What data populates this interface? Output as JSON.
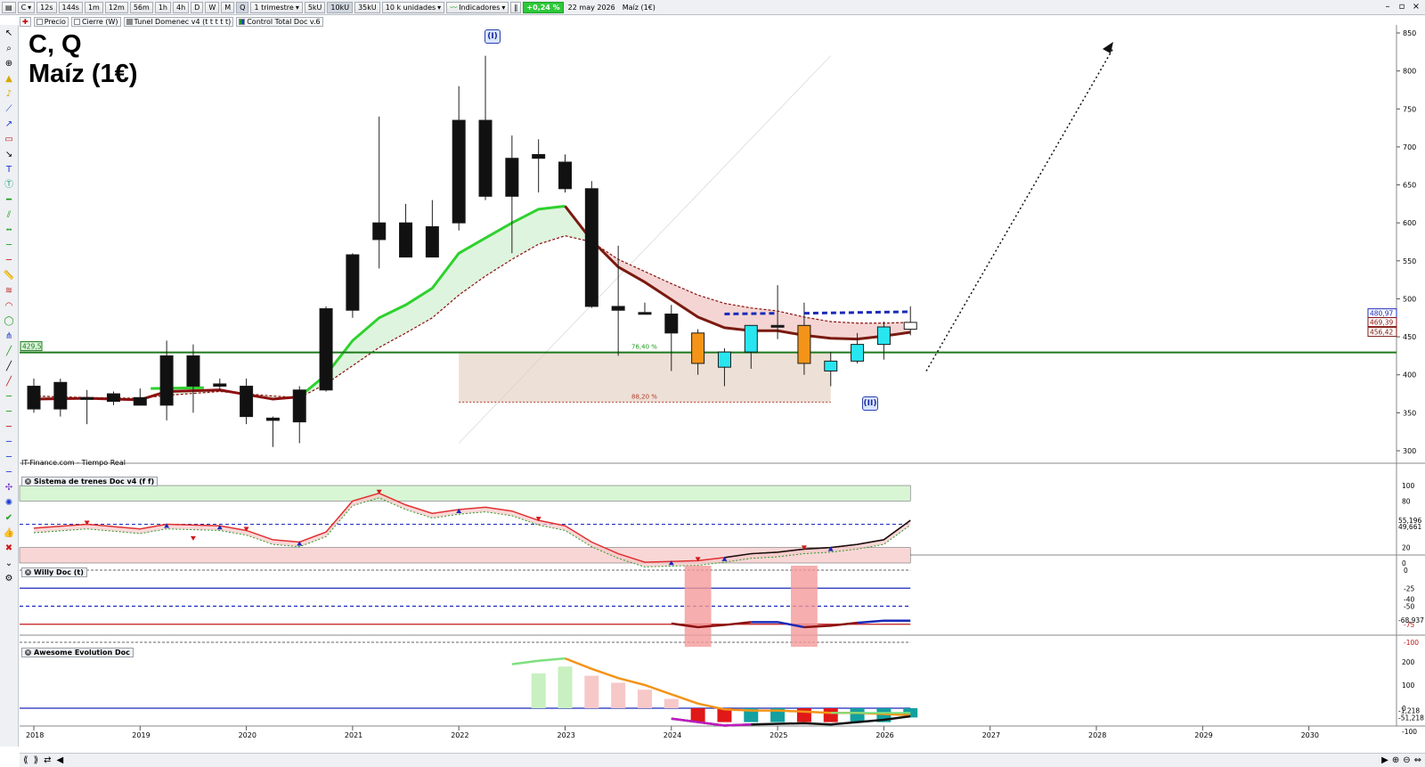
{
  "toolbar": {
    "symbol": "C",
    "timeframes": [
      "12s",
      "144s",
      "1m",
      "12m",
      "56m",
      "1h",
      "4h",
      "D",
      "W",
      "M",
      "Q"
    ],
    "period": "1 trimestre",
    "units": [
      "5kU",
      "10kU",
      "35kU"
    ],
    "units_select": "10 k unidades",
    "indicators_label": "Indicadores",
    "change": "+0,24 %",
    "date": "22 may 2026",
    "instrument": "Maíz (1€)"
  },
  "legend": {
    "price": "Precio",
    "close": "Cierre (W)",
    "tunnel": "Tunel Domenec v4 (t t t t t)",
    "control": "Control Total Doc v.6"
  },
  "title": {
    "line1": "C, Q",
    "line2": "Maíz (1€)"
  },
  "source": "IT-Finance.com - Tiempo Real",
  "waves": {
    "w1": "(I)",
    "w2": "(II)"
  },
  "fib": {
    "f1": "76,40 %",
    "f2": "88,20 %"
  },
  "price_tags": {
    "support": "429,5",
    "a": "480,97",
    "b": "469,39",
    "c": "456,42"
  },
  "panes": {
    "p1": "Sistema de trenes Doc v4 (f f)",
    "p2": "Willy Doc (t)",
    "p3": "Awesome Evolution Doc"
  },
  "pane_values": {
    "p1": [
      "55,196",
      "49,661"
    ],
    "p2": [
      "-68,937"
    ],
    "p3": [
      "-1,218",
      "-51,218"
    ]
  },
  "axes": {
    "price_ticks": [
      850,
      800,
      750,
      700,
      650,
      600,
      550,
      500,
      450,
      400,
      350,
      300
    ],
    "p1_ticks": [
      "100",
      "80",
      "20",
      "0"
    ],
    "p2_ticks": [
      "0",
      "-25",
      "-40",
      "-50",
      "-75",
      "-100"
    ],
    "p3_ticks": [
      "200",
      "100",
      "0",
      "-100"
    ],
    "years": [
      "2018",
      "2019",
      "2020",
      "2021",
      "2022",
      "2023",
      "2024",
      "2025",
      "2026",
      "2027",
      "2028",
      "2029",
      "2030"
    ]
  },
  "colors": {
    "bull_green": "#2ed12e",
    "bear_red": "#8b1010",
    "support_line": "#1c7a1c",
    "fib_box": "#e8d8cc",
    "cyan": "#28e6ef",
    "orange": "#f39419"
  },
  "chart_data": {
    "type": "candlestick",
    "timeframe": "quarterly",
    "series": [
      {
        "name": "candles",
        "ohlc": [
          [
            2018.0,
            385,
            395,
            350,
            355
          ],
          [
            2018.25,
            355,
            395,
            345,
            390
          ],
          [
            2018.5,
            370,
            380,
            335,
            370
          ],
          [
            2018.75,
            365,
            378,
            360,
            375
          ],
          [
            2019.0,
            370,
            382,
            360,
            360
          ],
          [
            2019.25,
            360,
            445,
            340,
            425
          ],
          [
            2019.5,
            425,
            440,
            350,
            385
          ],
          [
            2019.75,
            385,
            395,
            378,
            388
          ],
          [
            2020.0,
            385,
            395,
            335,
            345
          ],
          [
            2020.25,
            343,
            345,
            305,
            340
          ],
          [
            2020.5,
            338,
            385,
            310,
            380
          ],
          [
            2020.75,
            380,
            490,
            378,
            487
          ],
          [
            2021.0,
            485,
            560,
            475,
            558
          ],
          [
            2021.25,
            578,
            740,
            540,
            600
          ],
          [
            2021.5,
            600,
            625,
            560,
            555
          ],
          [
            2021.75,
            555,
            630,
            555,
            595
          ],
          [
            2022.0,
            600,
            780,
            590,
            735
          ],
          [
            2022.25,
            735,
            820,
            630,
            635
          ],
          [
            2022.5,
            635,
            715,
            560,
            685
          ],
          [
            2022.75,
            690,
            710,
            640,
            685
          ],
          [
            2023.0,
            680,
            690,
            640,
            645
          ],
          [
            2023.25,
            645,
            655,
            488,
            490
          ],
          [
            2023.5,
            490,
            570,
            425,
            485
          ],
          [
            2023.75,
            482,
            495,
            480,
            482
          ],
          [
            2024.0,
            480,
            492,
            405,
            455
          ],
          [
            2024.25,
            415,
            460,
            400,
            455
          ],
          [
            2024.5,
            410,
            435,
            385,
            430
          ],
          [
            2024.75,
            430,
            465,
            408,
            465
          ],
          [
            2025.0,
            465,
            518,
            447,
            463
          ],
          [
            2025.25,
            415,
            495,
            400,
            465
          ],
          [
            2025.5,
            405,
            430,
            385,
            418
          ],
          [
            2025.75,
            418,
            455,
            415,
            440
          ],
          [
            2026.0,
            440,
            470,
            420,
            463
          ],
          [
            2026.25,
            460,
            490,
            452,
            469
          ]
        ]
      }
    ],
    "support_level": 429.5,
    "ylim": [
      280,
      860
    ]
  }
}
